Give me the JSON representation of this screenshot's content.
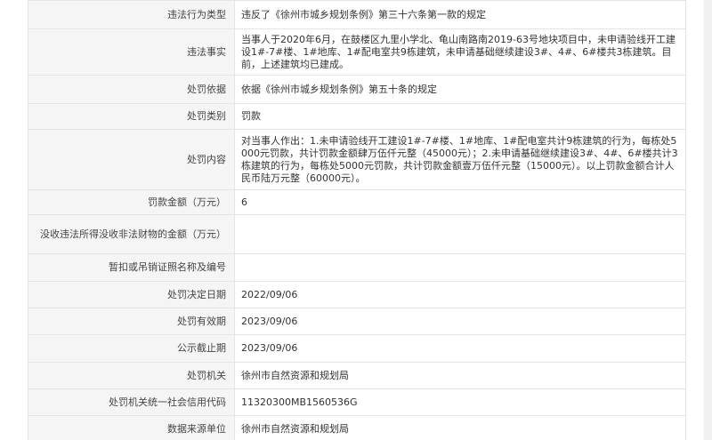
{
  "rows": [
    {
      "label": "违法行为类型",
      "value": "违反了《徐州市城乡规划条例》第三十六条第一款的规定",
      "h": 32
    },
    {
      "label": "违法事实",
      "value": "当事人于2020年6月，在鼓楼区九里小学北、龟山南路南2019-63号地块项目中，未申请验线开工建设1#-7#楼、1#地库、1#配电室共9栋建筑，未申请基础继续建设3#、4#、6#楼共3栋建筑。目前，上述建筑均已建成。",
      "h": 52
    },
    {
      "label": "处罚依据",
      "value": "依据《徐州市城乡规划条例》第五十条的规定",
      "h": 32
    },
    {
      "label": "处罚类别",
      "value": "罚款",
      "h": 29
    },
    {
      "label": "处罚内容",
      "value": "对当事人作出：1.未申请验线开工建设1#-7#楼、1#地库、1#配电室共计9栋建筑的行为，每栋处5000元罚款，共计罚款金额肆万伍仟元整（45000元）；2.未申请基础继续建设3#、4#、6#楼共计3栋建筑的行为，每栋处5000元罚款，共计罚款金额壹万伍仟元整（15000元）。以上罚款金额合计人民币陆万元整（60000元）。",
      "h": 68
    },
    {
      "label": "罚款金额（万元）",
      "value": "6",
      "h": 28
    },
    {
      "label": "没收违法所得没收非法财物的金额（万元）",
      "value": "",
      "h": 44
    },
    {
      "label": "暂扣或吊销证照名称及编号",
      "value": "",
      "h": 31
    },
    {
      "label": "处罚决定日期",
      "value": "2022/09/06",
      "h": 30
    },
    {
      "label": "处罚有效期",
      "value": "2023/09/06",
      "h": 30
    },
    {
      "label": "公示截止期",
      "value": "2023/09/06",
      "h": 31
    },
    {
      "label": "处罚机关",
      "value": "徐州市自然资源和规划局",
      "h": 30
    },
    {
      "label": "处罚机关统一社会信用代码",
      "value": "11320300MB1560536G",
      "h": 30
    },
    {
      "label": "数据来源单位",
      "value": "徐州市自然资源和规划局",
      "h": 30
    }
  ]
}
